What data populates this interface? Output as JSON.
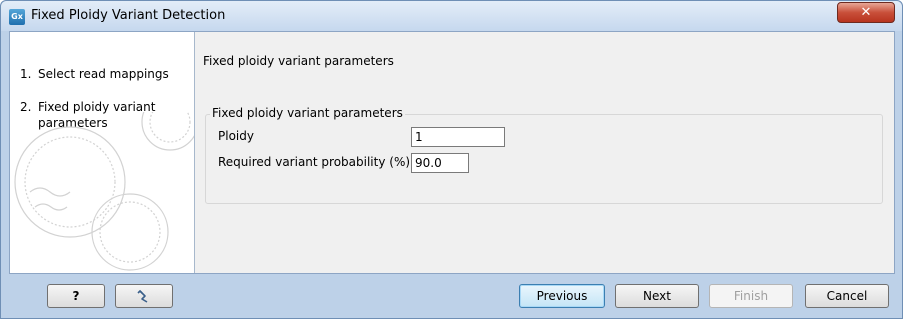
{
  "window": {
    "title": "Fixed Ploidy Variant Detection",
    "app_icon_text": "Gx",
    "close_icon": "close-icon"
  },
  "steps": [
    {
      "number": "1.",
      "label": "Select read mappings"
    },
    {
      "number": "2.",
      "label": "Fixed ploidy variant parameters"
    }
  ],
  "main": {
    "section_title": "Fixed ploidy variant parameters",
    "group_title": "Fixed ploidy variant parameters",
    "fields": [
      {
        "label": "Ploidy",
        "value": "1"
      },
      {
        "label": "Required variant probability (%)",
        "value": "90.0"
      }
    ]
  },
  "footer": {
    "help_label": "?",
    "reset_icon": "reset-icon",
    "previous_label": "Previous",
    "next_label": "Next",
    "finish_label": "Finish",
    "cancel_label": "Cancel"
  },
  "colors": {
    "titlebar": "#c6d8ee",
    "close_button": "#c9503a",
    "frame": "#bdd1e8"
  }
}
